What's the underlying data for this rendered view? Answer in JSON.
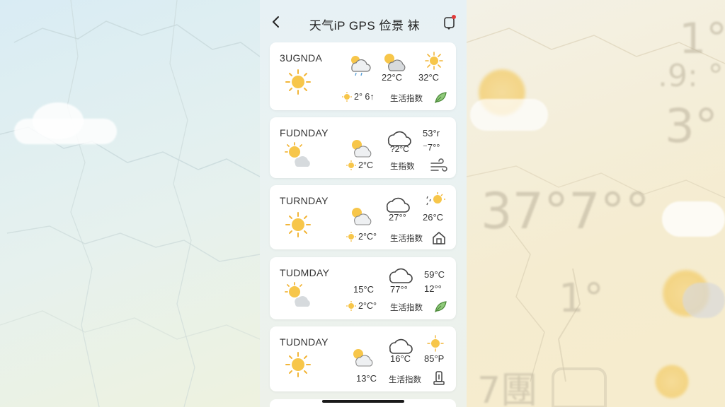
{
  "app": {
    "title": "天气iP GPS 俭景 袜",
    "back_icon": "chevron-left-icon",
    "notification_icon": "notification-bell-icon"
  },
  "cards": [
    {
      "day": "3UGNDA",
      "temp_a": "22°C",
      "temp_b": "32°C",
      "mini_text": "2° 6↑",
      "mini_suffix": "",
      "life_label": "生活指数",
      "tail_icon": "leaf-icon"
    },
    {
      "day": "FUDNDAY",
      "temp_a": "?2°C",
      "temp_b": "53°r",
      "temp_c": "⁻7°°",
      "mini_text": "2°C",
      "life_label": "生指数",
      "tail_icon": "wind-icon"
    },
    {
      "day": "TURNDAY",
      "temp_a": "27°°",
      "temp_b": "26°C",
      "mini_text": "2°C°",
      "life_label": "生活指数",
      "tail_icon": "house-icon"
    },
    {
      "day": "TUDMDAY",
      "temp_a": "15°C",
      "temp_b": "77°°",
      "temp_c": "59°C",
      "temp_d": "12°°",
      "mini_text": "2°C°",
      "life_label": "生活指数",
      "tail_icon": "leaf-icon"
    },
    {
      "day": "TUDNDAY",
      "temp_a": "16°C",
      "temp_b": "85°P",
      "temp_c": "13°C",
      "life_label": "生活指数",
      "tail_icon": "thermometer-icon"
    }
  ],
  "background_right": {
    "big_1": "1°",
    "small_1": ".9: °",
    "big_2": "3°",
    "big_3": "37°7°°",
    "big_4": "1°",
    "big_5": "7團"
  }
}
